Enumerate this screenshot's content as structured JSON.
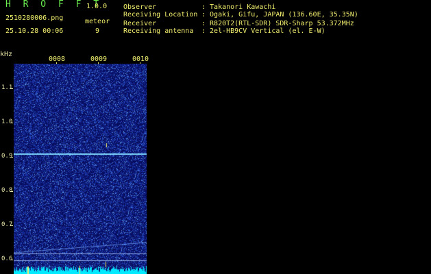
{
  "app": {
    "name": "H R O F F T",
    "version": "1.0.0"
  },
  "file": {
    "name": "2510280006.png",
    "timestamp": "25.10.28 00:06"
  },
  "meteor": {
    "label": "meteor",
    "count": "9"
  },
  "info": [
    {
      "key": "Observer",
      "value": ": Takanori Kawachi"
    },
    {
      "key": "Receiving Location",
      "value": ": Ogaki, Gifu, JAPAN (136.60E, 35.35N)"
    },
    {
      "key": "Receiver",
      "value": ": R820T2(RTL-SDR) SDR-Sharp 53.372MHz"
    },
    {
      "key": "Receiving antenna",
      "value": ": 2el-HB9CV Vertical (el. E-W)"
    }
  ],
  "axis": {
    "unit": "kHz",
    "yticks": [
      "1.1",
      "1.0",
      "0.9",
      "0.8",
      "0.7",
      "0.6"
    ],
    "xticks": [
      "0008",
      "0009",
      "0010"
    ]
  },
  "colors": {
    "background": "#000000",
    "spectrogram_bg": "#0a0f6a",
    "carrier_line": "#7fd8ff",
    "signal_bar": "#00eaff",
    "text_green": "#6cf050",
    "text_yellow": "#f2ee6e"
  }
}
